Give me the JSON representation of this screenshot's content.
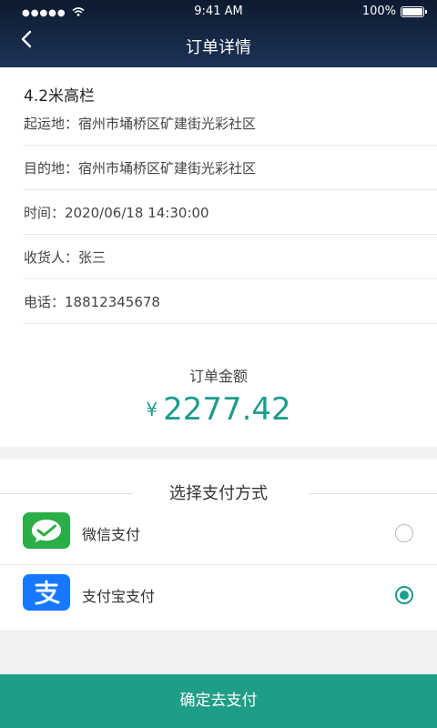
{
  "status_bar": {
    "signal_dots": "●●●●●",
    "time": "9:41 AM",
    "battery_percent": "100%"
  },
  "header": {
    "title": "订单详情"
  },
  "order": {
    "truck_type": "4.2米高栏",
    "rows": [
      {
        "label": "起运地：宿州市埇桥区矿建街光彩社区"
      },
      {
        "label": "目的地：宿州市埇桥区矿建街光彩社区"
      },
      {
        "label": "时间：2020/06/18 14:30:00"
      },
      {
        "label": "收货人：张三"
      },
      {
        "label": "电话：18812345678"
      }
    ],
    "amount_label": "订单金额",
    "currency_symbol": "¥",
    "amount": "2277.42"
  },
  "payment": {
    "title": "选择支付方式",
    "methods": [
      {
        "label": "微信支付",
        "icon": "wechat-pay-icon",
        "selected": false,
        "color": "#2aae47"
      },
      {
        "label": "支付宝支付",
        "icon": "alipay-icon",
        "selected": true,
        "color": "#1678ff"
      }
    ]
  },
  "footer": {
    "confirm_label": "确定去支付"
  },
  "colors": {
    "accent": "#1e9c8c",
    "header_dark": "#0d1a2f",
    "header_light": "#1d3356"
  }
}
